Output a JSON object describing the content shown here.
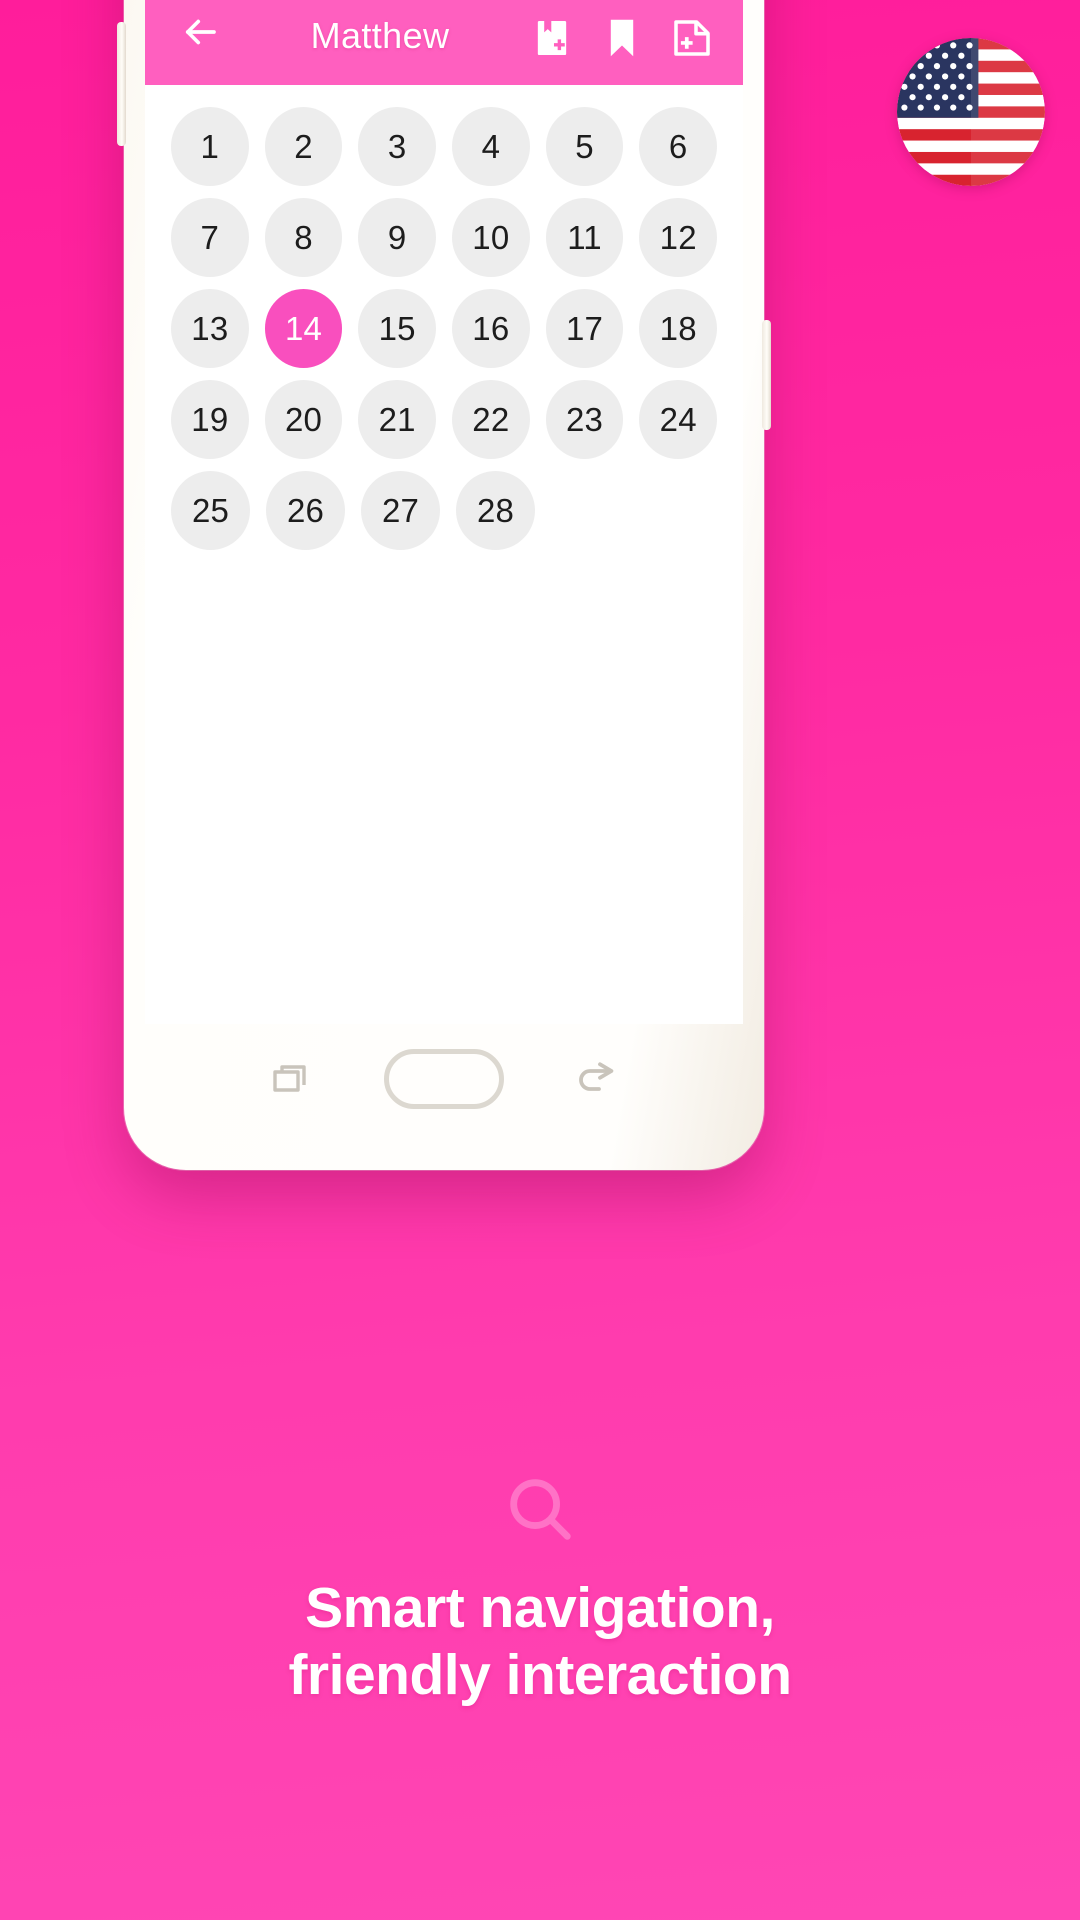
{
  "background": {
    "color_start": "#ff1d9b",
    "color_end": "#ff46b4"
  },
  "phone": {
    "appbar": {
      "accent_color": "#ff5fbf",
      "back_icon": "arrow-left-icon",
      "title": "Matthew",
      "actions": [
        {
          "name": "save-bookmark-icon",
          "label": "Save"
        },
        {
          "name": "bookmark-icon",
          "label": "Bookmark"
        },
        {
          "name": "add-note-icon",
          "label": "Add note"
        }
      ]
    },
    "chapter_grid": {
      "selected": "14",
      "selected_color": "#f94fbe",
      "chip_color": "#ededed",
      "rows": [
        [
          "1",
          "2",
          "3",
          "4",
          "5",
          "6"
        ],
        [
          "7",
          "8",
          "9",
          "10",
          "11",
          "12"
        ],
        [
          "13",
          "14",
          "15",
          "16",
          "17",
          "18"
        ],
        [
          "19",
          "20",
          "21",
          "22",
          "23",
          "24"
        ],
        [
          "25",
          "26",
          "27",
          "28"
        ]
      ]
    },
    "navbar": {
      "recents_icon": "recents-icon",
      "home_icon": "home-button",
      "back_icon": "back-icon"
    }
  },
  "flag_badge": {
    "name": "us-flag-icon",
    "label": "United States"
  },
  "caption": {
    "icon": "search-icon",
    "line1": "Smart navigation,",
    "line2": "friendly interaction",
    "color": "#ffffff"
  }
}
